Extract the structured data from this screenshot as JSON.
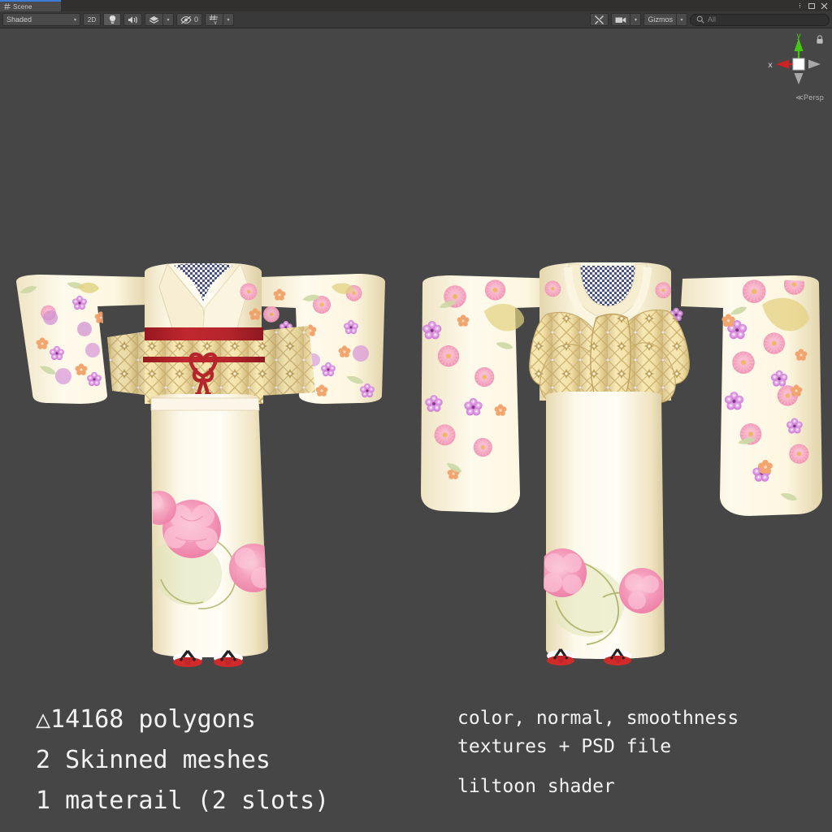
{
  "window": {
    "tab_label": "Scene",
    "tab_icon": "grid-icon",
    "controls": {
      "menu": "kebab-menu-icon",
      "maximize": "maximize-icon",
      "close": "close-icon"
    }
  },
  "toolbar": {
    "draw_mode": "Shaded",
    "draw_mode_caret": "▾",
    "two_d_toggle": "2D",
    "lighting_icon": "lightbulb-icon",
    "audio_icon": "audio-icon",
    "fx_icon": "effects-icon",
    "fx_caret": "▾",
    "hidden_objects_count": "0",
    "hidden_objects_icon": "eye-off-icon",
    "grid_icon": "grid-snap-icon",
    "grid_caret": "▾",
    "tools_icon": "tools-icon",
    "camera_icon": "camera-icon",
    "camera_caret": "▾",
    "gizmos_label": "Gizmos",
    "gizmos_caret": "▾",
    "search_placeholder": "All",
    "search_value": "",
    "search_icon": "search-icon"
  },
  "gizmo": {
    "axis_x_label": "x",
    "axis_y_label": "y",
    "projection_label": "Persp",
    "projection_prefix": "≪",
    "lock_icon": "lock-icon",
    "color_x": "#cc2222",
    "color_y": "#44c814",
    "color_z": "#a8a8a8",
    "center_color": "#ffffff"
  },
  "annotations": {
    "left": [
      "△14168 polygons",
      "2 Skinned meshes",
      "1 materail (2 slots)"
    ],
    "right_group1": [
      "color, normal, smoothness",
      "textures + PSD file"
    ],
    "right_group2": [
      "liltoon shader"
    ]
  },
  "scene": {
    "background_color": "#464646",
    "objects": [
      {
        "name": "kimono-front-view",
        "description": "Japanese furisode kimono, front view, cream with pink chrysanthemum and purple floral print, gold patterned obi with red obijime cord and decorative knot, white geta sandals with red straps"
      },
      {
        "name": "kimono-back-view",
        "description": "Japanese furisode kimono, back view, gold patterned obi tied in large bow, checkered navy collar lining, cream skirt with pink peony print, white geta sandals with red straps"
      }
    ],
    "palette": {
      "fabric_cream": "#fdf7e2",
      "fabric_shadow": "#e9dcb4",
      "obi_gold": "#f4e3a8",
      "obi_gold_dark": "#cbb06a",
      "cord_red": "#b5252c",
      "flower_pink": "#f49ab8",
      "flower_magenta": "#c860c8",
      "flower_orange": "#f0a46a",
      "leaf_green": "#cfd9a8",
      "collar_navy": "#4a5480",
      "sandal_red": "#d02a2a"
    }
  }
}
